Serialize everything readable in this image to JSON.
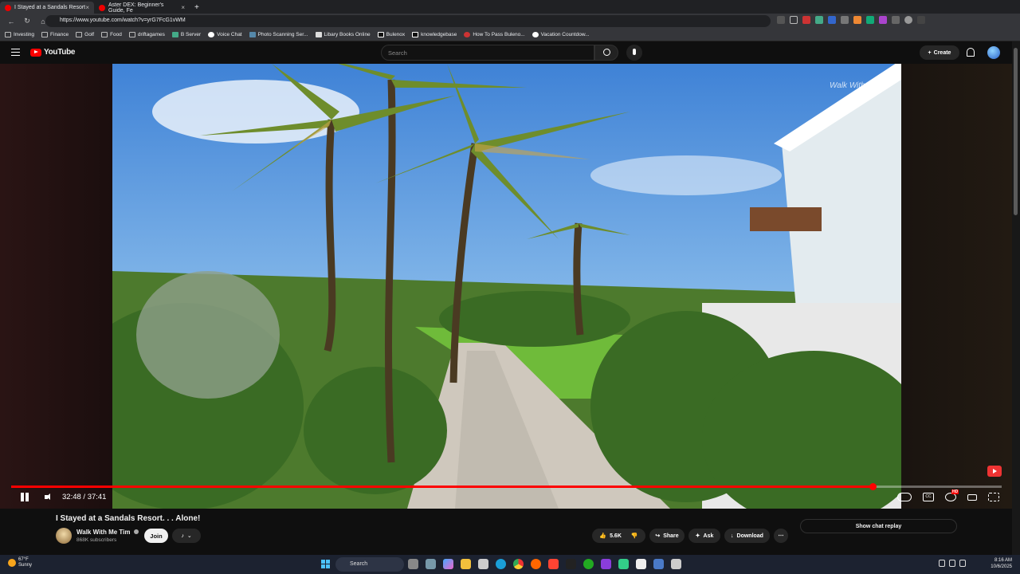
{
  "browser": {
    "tabs": [
      {
        "label": "I Stayed at a Sandals Resort",
        "active": true
      },
      {
        "label": "Aster DEX: Beginner's Guide, Fe",
        "active": false
      }
    ],
    "url": "https://www.youtube.com/watch?v=yrG7FcG1vWM",
    "bookmarks": [
      "Investing",
      "Finance",
      "Golf",
      "Food",
      "driftagames",
      "B Server",
      "Voice Chat",
      "Photo Scanning Ser...",
      "Libary Books Online",
      "Bulenox",
      "knowledgebase",
      "How To Pass Buleno...",
      "Vacation Countdow..."
    ]
  },
  "youtube": {
    "logo_text": "YouTube",
    "search_placeholder": "Search",
    "create_label": "Create"
  },
  "player": {
    "watermark": "Walk With Me",
    "current_time": "32:48",
    "duration": "37:41",
    "time_display": "32:48 / 37:41",
    "progress_fraction": 0.87,
    "controls": [
      "cc-icon",
      "settings-icon",
      "theater-icon",
      "fullscreen-icon"
    ],
    "hd_badge": "HD"
  },
  "video_info": {
    "title": "I Stayed at a Sandals Resort. . . Alone!",
    "channel_name": "Walk With Me Tim",
    "subscribers": "868K subscribers",
    "join_label": "Join",
    "like_count": "5.6K",
    "share_label": "Share",
    "ask_label": "Ask",
    "download_label": "Download",
    "show_chat_label": "Show chat replay"
  },
  "taskbar": {
    "weather_temp": "67°F",
    "weather_desc": "Sunny",
    "search_label": "Search",
    "time": "8:16 AM",
    "date": "10/6/2025"
  },
  "colors": {
    "accent_red": "#ff0000",
    "background": "#0f0f0f",
    "chrome_bg": "#35363a"
  }
}
